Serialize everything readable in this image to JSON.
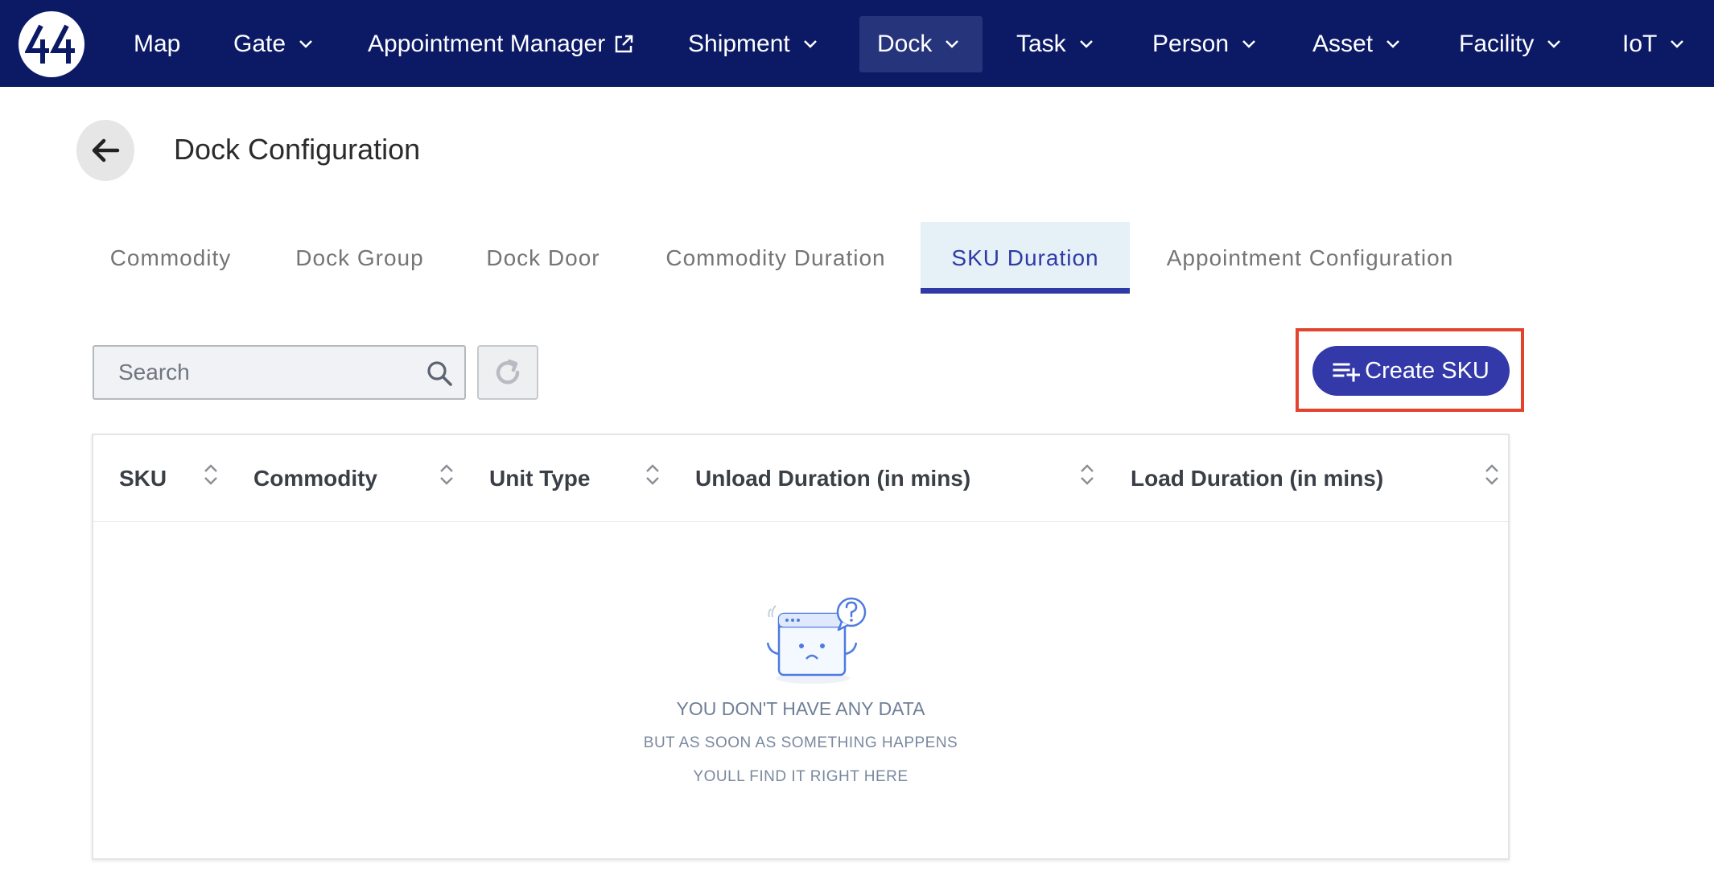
{
  "app": {
    "logo_text": "44"
  },
  "nav": {
    "items": [
      {
        "label": "Map",
        "has_dropdown": false
      },
      {
        "label": "Gate",
        "has_dropdown": true
      },
      {
        "label": "Appointment Manager",
        "external": true
      },
      {
        "label": "Shipment",
        "has_dropdown": true
      },
      {
        "label": "Dock",
        "has_dropdown": true,
        "active": true
      },
      {
        "label": "Task",
        "has_dropdown": true
      },
      {
        "label": "Person",
        "has_dropdown": true
      },
      {
        "label": "Asset",
        "has_dropdown": true
      },
      {
        "label": "Facility",
        "has_dropdown": true
      },
      {
        "label": "IoT",
        "has_dropdown": true
      }
    ]
  },
  "page": {
    "title": "Dock Configuration",
    "back_icon": "arrow-left-icon"
  },
  "tabs": [
    {
      "label": "Commodity"
    },
    {
      "label": "Dock Group"
    },
    {
      "label": "Dock Door"
    },
    {
      "label": "Commodity Duration"
    },
    {
      "label": "SKU Duration",
      "active": true
    },
    {
      "label": "Appointment Configuration"
    }
  ],
  "toolbar": {
    "search_placeholder": "Search",
    "search_value": "",
    "create_label": "Create SKU"
  },
  "table": {
    "columns": [
      "SKU",
      "Commodity",
      "Unit Type",
      "Unload Duration (in mins)",
      "Load Duration (in mins)"
    ],
    "rows": []
  },
  "empty_state": {
    "title": "YOU DON'T HAVE ANY DATA",
    "line1": "BUT AS SOON AS SOMETHING HAPPENS",
    "line2": "YOULL FIND IT RIGHT HERE"
  },
  "colors": {
    "nav_bg": "#0c1a66",
    "nav_active_bg": "#26347c",
    "accent": "#3339a8",
    "active_tab_bg": "#e5f0f7",
    "highlight": "#e3422d"
  }
}
